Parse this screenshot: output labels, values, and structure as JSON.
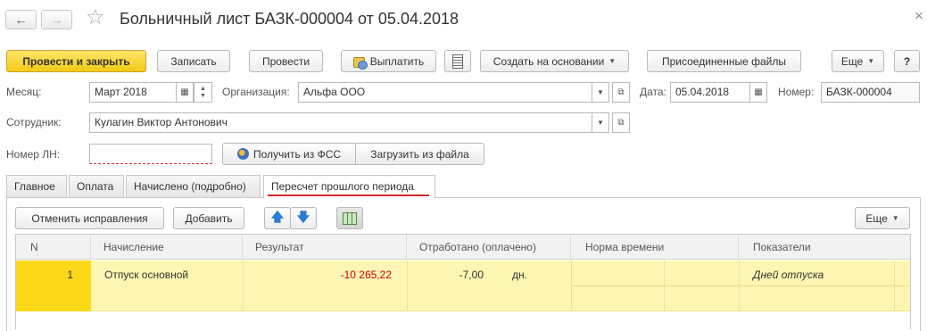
{
  "window": {
    "title": "Больничный лист БАЗК-000004 от 05.04.2018",
    "back_icon": "←",
    "forward_icon": "→",
    "star_icon": "☆",
    "close_icon": "×"
  },
  "toolbar": {
    "post_and_close": "Провести и закрыть",
    "save": "Записать",
    "post": "Провести",
    "pay": "Выплатить",
    "create_based_on": "Создать на основании",
    "attached_files": "Присоединенные файлы",
    "more": "Еще",
    "help": "?"
  },
  "form": {
    "month_label": "Месяц:",
    "month_value": "Март 2018",
    "org_label": "Организация:",
    "org_value": "Альфа ООО",
    "date_label": "Дата:",
    "date_value": "05.04.2018",
    "number_label": "Номер:",
    "number_value": "БАЗК-000004",
    "employee_label": "Сотрудник:",
    "employee_value": "Кулагин Виктор Антонович",
    "ln_label": "Номер ЛН:",
    "ln_value": "",
    "get_from_fss": "Получить из ФСС",
    "load_from_file": "Загрузить из файла"
  },
  "tabs": [
    {
      "label": "Главное"
    },
    {
      "label": "Оплата"
    },
    {
      "label": "Начислено (подробно)"
    },
    {
      "label": "Пересчет прошлого периода"
    }
  ],
  "tab_toolbar": {
    "cancel_corrections": "Отменить исправления",
    "add": "Добавить",
    "more": "Еще"
  },
  "table": {
    "headers": [
      "N",
      "Начисление",
      "Результат",
      "Отработано (оплачено)",
      "Норма времени",
      "Показатели"
    ],
    "rows": [
      {
        "n": "1",
        "accrual": "Отпуск основной",
        "result": "-10 265,22",
        "worked": "-7,00",
        "unit": "дн.",
        "norm": "",
        "indicators": "Дней отпуска"
      }
    ]
  },
  "colors": {
    "accent_yellow": "#f3c916",
    "row_highlight": "#fdf6b3",
    "row_selected": "#fbd818",
    "negative": "#cc0000",
    "tab_underline": "#d9262b"
  }
}
